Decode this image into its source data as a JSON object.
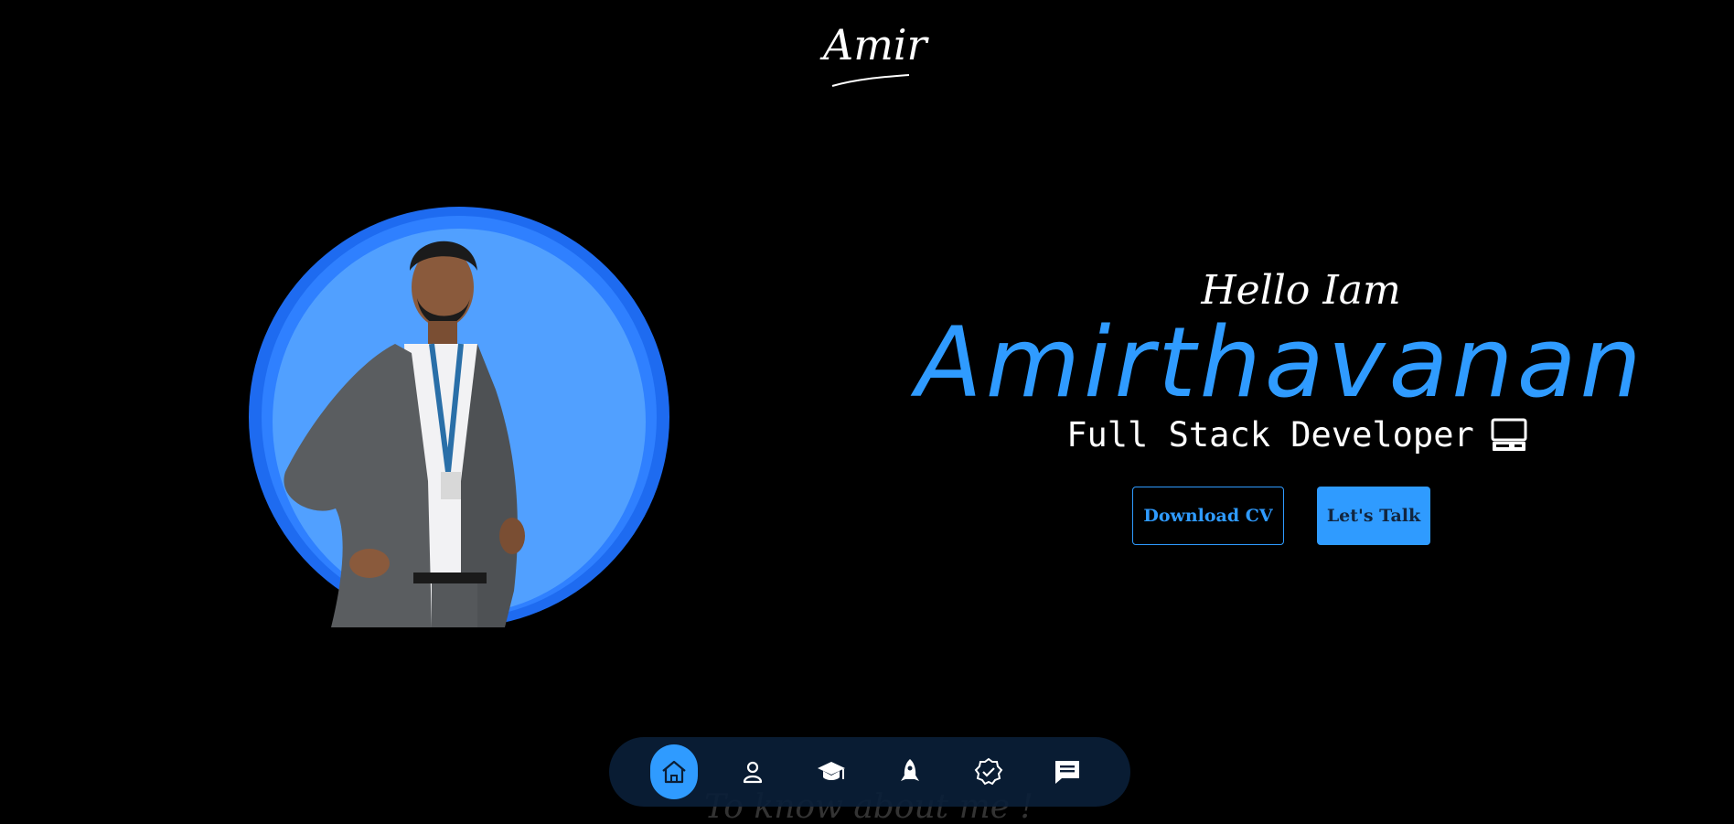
{
  "brand": {
    "logo_text": "Amir"
  },
  "hero": {
    "greeting": "Hello Iam",
    "name": "Amirthavanan",
    "role": "Full Stack Developer",
    "role_icon": "computer-icon"
  },
  "buttons": {
    "download_cv": "Download CV",
    "lets_talk": "Let's Talk"
  },
  "next_section_peek": "To know about me !",
  "dock": {
    "items": [
      {
        "name": "home",
        "icon": "home-icon",
        "active": true
      },
      {
        "name": "about",
        "icon": "user-icon",
        "active": false
      },
      {
        "name": "education",
        "icon": "graduation-cap-icon",
        "active": false
      },
      {
        "name": "projects",
        "icon": "rocket-icon",
        "active": false
      },
      {
        "name": "skills",
        "icon": "badge-check-icon",
        "active": false
      },
      {
        "name": "contact",
        "icon": "message-icon",
        "active": false
      }
    ]
  },
  "colors": {
    "background": "#000000",
    "accent": "#2f9bff",
    "circle_outer": "#1e6bf0",
    "circle_inner": "#51a0ff",
    "dock_bg": "#0a1e37"
  }
}
